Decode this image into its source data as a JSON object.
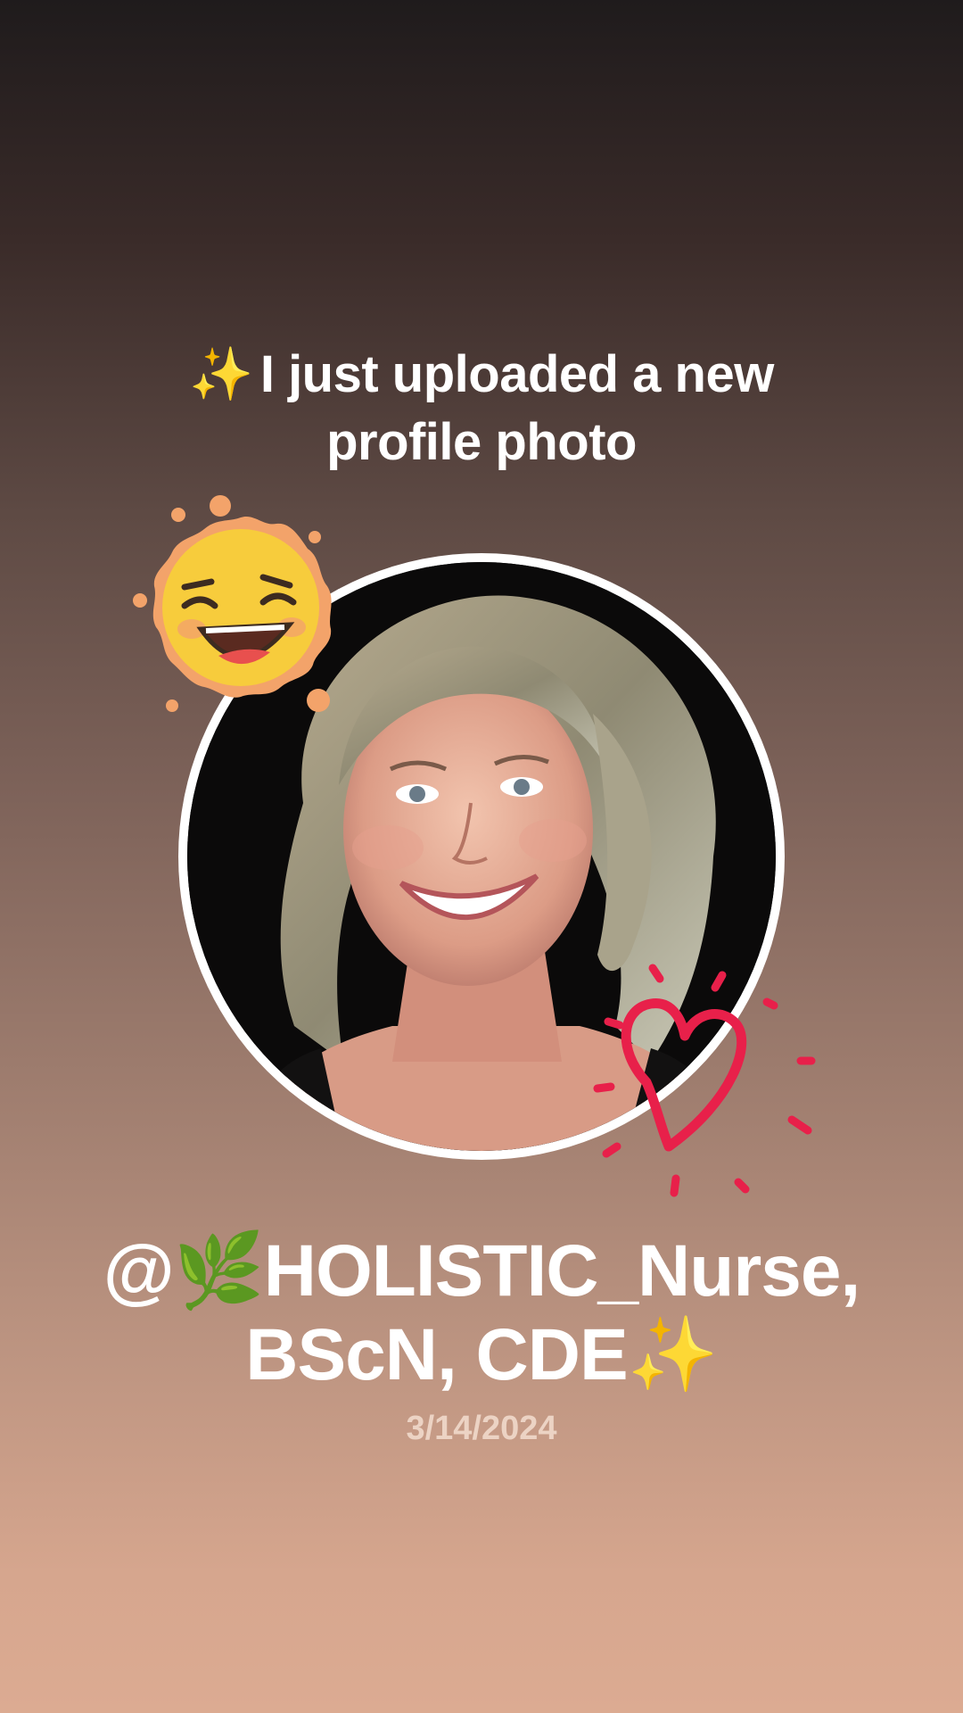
{
  "headline": {
    "sparkle": "✨",
    "text": "I just uploaded a new profile photo"
  },
  "profile": {
    "handle_line1": "@🌿HOLISTIC_Nurse,",
    "handle_line2": "BScN, CDE✨",
    "date": "3/14/2024"
  },
  "stickers": {
    "sun": "laughing-sun-icon",
    "heart": "doodle-heart-icon"
  },
  "colors": {
    "heart_red": "#e8204a",
    "sun_yellow": "#f7cc3c",
    "sun_orange": "#f3a36a"
  }
}
